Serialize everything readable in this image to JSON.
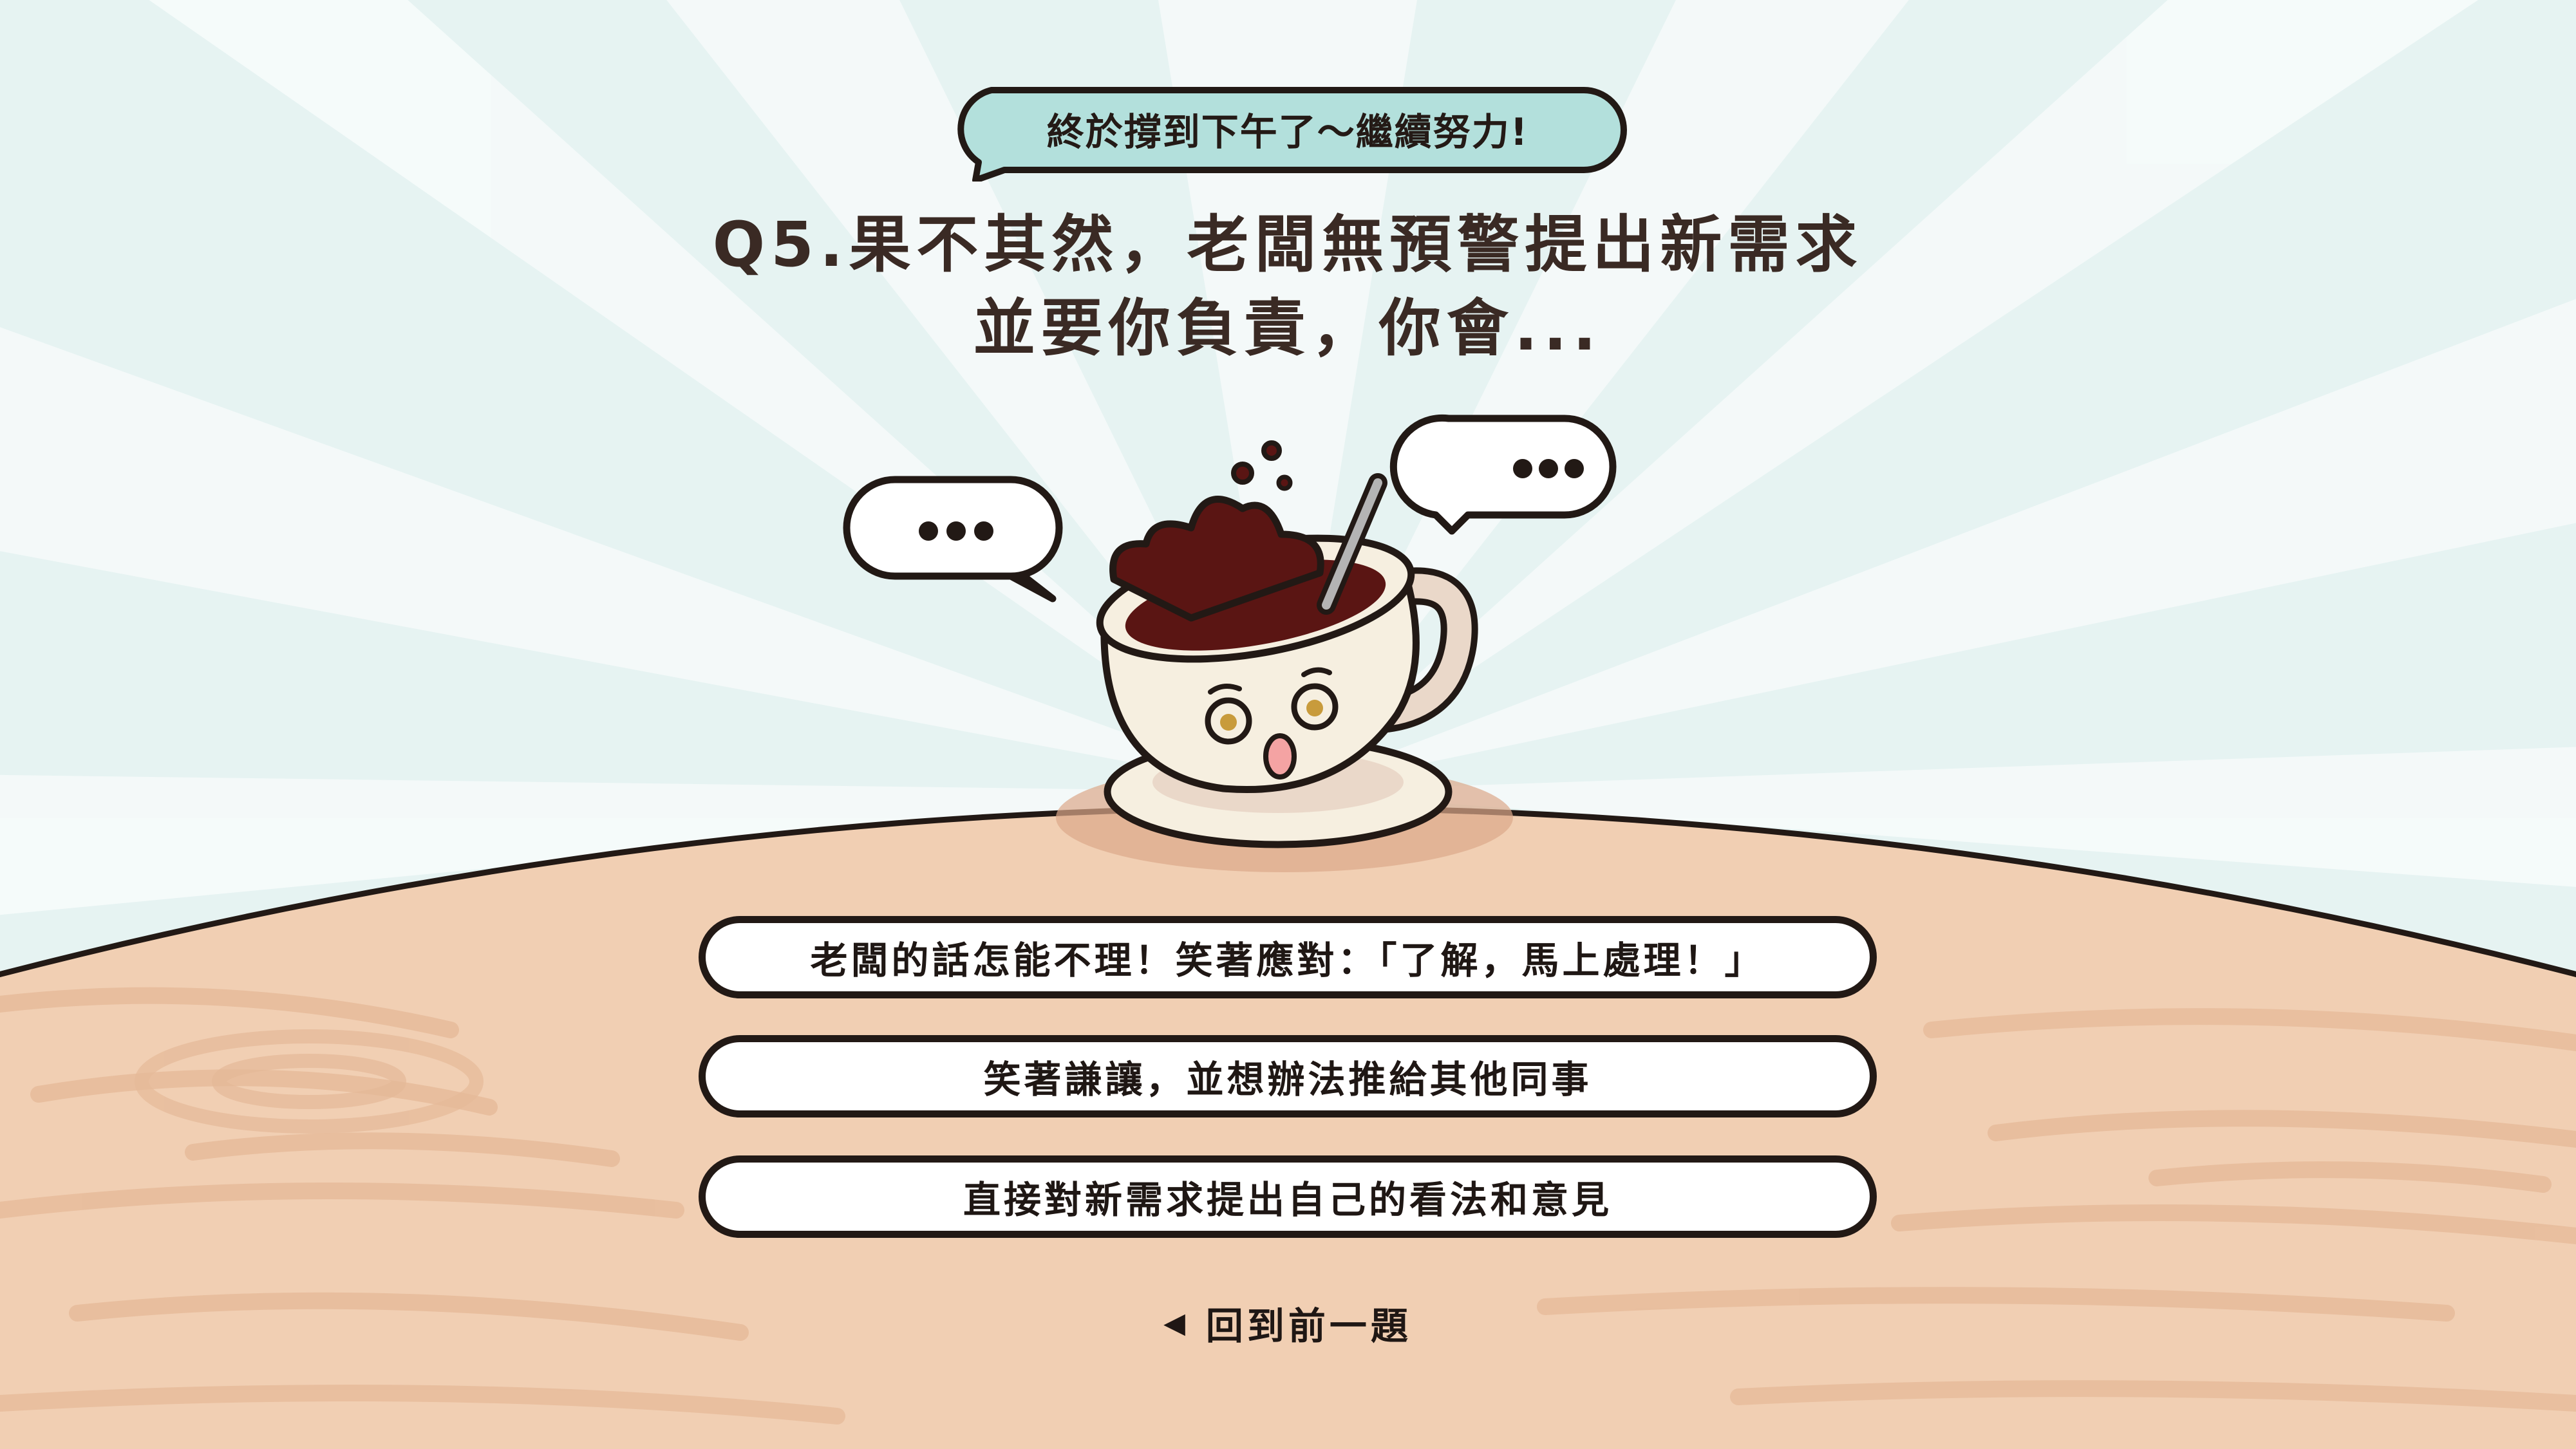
{
  "header_bubble": {
    "text": "終於撐到下午了～繼續努力!"
  },
  "question": {
    "line1": "Q5.果不其然，老闆無預警提出新需求",
    "line2": "並要你負責，你會..."
  },
  "speech_bubbles": {
    "left": "•••",
    "right": "•••"
  },
  "options": [
    {
      "label": "老闆的話怎能不理！笑著應對：「了解，馬上處理！」"
    },
    {
      "label": "笑著謙讓，並想辦法推給其他同事"
    },
    {
      "label": "直接對新需求提出自己的看法和意見"
    }
  ],
  "back": {
    "icon": "◀",
    "label": "回到前一題"
  },
  "colors": {
    "sky": "#eaf5f4",
    "sky_ray": "#f7fbfb",
    "bubble_fill": "#b3e0dc",
    "table": "#f1cfb3",
    "table_grain": "#e5b998",
    "outline": "#221915",
    "coffee": "#5a1513",
    "cup": "#f6efe0"
  },
  "icons": {
    "back": "triangle-left-icon",
    "cup": "coffee-cup-icon",
    "speech": "speech-bubble-icon"
  }
}
